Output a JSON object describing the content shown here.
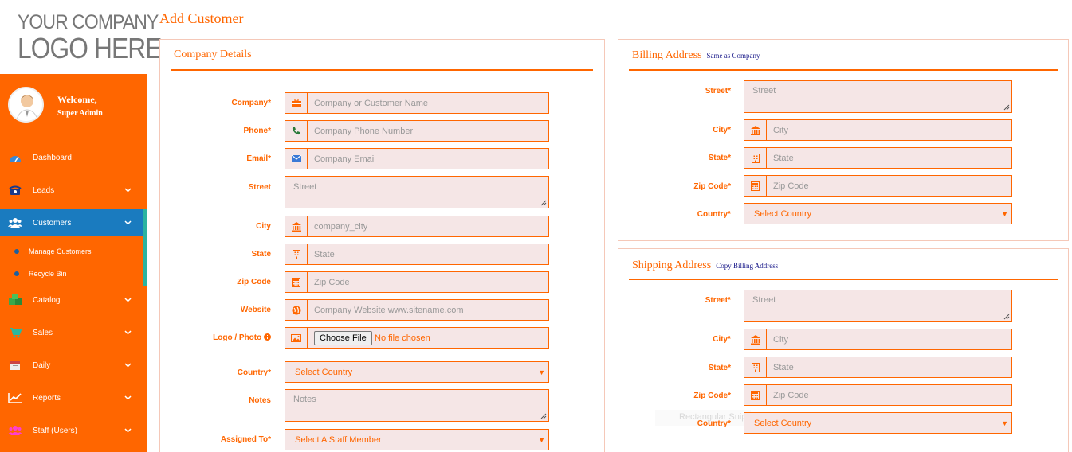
{
  "logo": {
    "line1": "YOUR COMPANY",
    "line2": "LOGO HERE"
  },
  "profile": {
    "welcome": "Welcome,",
    "username": "Super Admin"
  },
  "nav": {
    "dashboard": "Dashboard",
    "leads": "Leads",
    "customers": "Customers",
    "manage_customers": "Manage Customers",
    "recycle_bin": "Recycle Bin",
    "catalog": "Catalog",
    "sales": "Sales",
    "daily": "Daily",
    "reports": "Reports",
    "staff": "Staff (Users)"
  },
  "page": {
    "title": "Add Customer"
  },
  "company": {
    "title": "Company Details",
    "company_label": "Company*",
    "company_ph": "Company or Customer Name",
    "phone_label": "Phone*",
    "phone_ph": "Company Phone Number",
    "email_label": "Email*",
    "email_ph": "Company Email",
    "street_label": "Street",
    "street_ph": "Street",
    "city_label": "City",
    "city_ph": "company_city",
    "state_label": "State",
    "state_ph": "State",
    "zip_label": "Zip Code",
    "zip_ph": "Zip Code",
    "website_label": "Website",
    "website_ph": "Company Website www.sitename.com",
    "logo_label": "Logo / Photo",
    "file_button": "Choose File",
    "file_status": "No file chosen",
    "country_label": "Country*",
    "country_value": "Select Country",
    "notes_label": "Notes",
    "notes_ph": "Notes",
    "assigned_label": "Assigned To*",
    "assigned_value": "Select A Staff Member"
  },
  "billing": {
    "title": "Billing Address",
    "link": "Same as Company",
    "street_label": "Street*",
    "street_ph": "Street",
    "city_label": "City*",
    "city_ph": "City",
    "state_label": "State*",
    "state_ph": "State",
    "zip_label": "Zip Code*",
    "zip_ph": "Zip Code",
    "country_label": "Country*",
    "country_value": "Select Country"
  },
  "shipping": {
    "title": "Shipping Address",
    "link": "Copy Billing Address",
    "street_label": "Street*",
    "street_ph": "Street",
    "city_label": "City*",
    "city_ph": "City",
    "state_label": "State*",
    "state_ph": "State",
    "zip_label": "Zip Code*",
    "zip_ph": "Zip Code",
    "country_label": "Country*",
    "country_value": "Select Country"
  },
  "overlay": {
    "snip": "Rectangular Snip"
  },
  "colors": {
    "accent": "#ff6600",
    "active_nav": "#1a7bbf",
    "field_bg": "#f5e6e6"
  }
}
